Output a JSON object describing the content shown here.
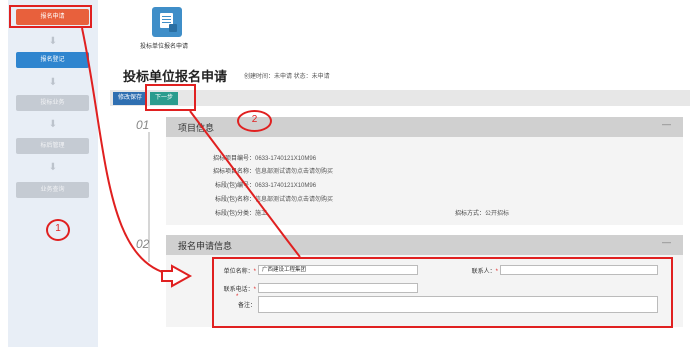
{
  "sidebar": {
    "items": [
      {
        "label": "报名申请"
      },
      {
        "label": "报名登记"
      },
      {
        "label": "投标业务"
      },
      {
        "label": "标后管理"
      },
      {
        "label": "业务查询"
      }
    ],
    "arrow_glyph": "⬇"
  },
  "toolbar": {
    "label": "投标单位报名申请"
  },
  "header": {
    "title": "投标单位报名申请",
    "meta": "创建时间：未申请  状态：未申请"
  },
  "actions": {
    "save_label": "修改保存",
    "next_label": "下一步"
  },
  "steps": [
    {
      "num": "01",
      "title": "项目信息",
      "collapse": "—"
    },
    {
      "num": "02",
      "title": "报名申请信息",
      "collapse": "—"
    }
  ],
  "project_info": {
    "rows": [
      {
        "label": "招标项目编号：",
        "value": "0633-1740121X10M96"
      },
      {
        "label": "招标项目名称：",
        "value": "信息部测试请勿点击请勿购买"
      },
      {
        "label": "标段(包)编号：",
        "value": "0633-1740121X10M96"
      },
      {
        "label": "标段(包)名称：",
        "value": "信息部测试请勿点击请勿购买"
      },
      {
        "label": "标段(包)分类：",
        "value": "施工"
      }
    ],
    "method_label": "招标方式：",
    "method_value": "公开招标"
  },
  "form": {
    "unit_label": "单位名称：",
    "unit_value": "广西建设工程集团",
    "contact_label": "联系人：",
    "contact_value": "",
    "phone_label": "联系电话：",
    "phone_value": "",
    "remark_label": "备注：",
    "remark_value": "",
    "required_mark": "*"
  },
  "annotations": [
    {
      "num": "1"
    },
    {
      "num": "2"
    }
  ],
  "colors": {
    "annotation": "#e02020",
    "active_nav": "#e8603c",
    "nav_blue": "#2f85cf",
    "save_button": "#2f6fb1",
    "next_button": "#2b9c8e"
  }
}
